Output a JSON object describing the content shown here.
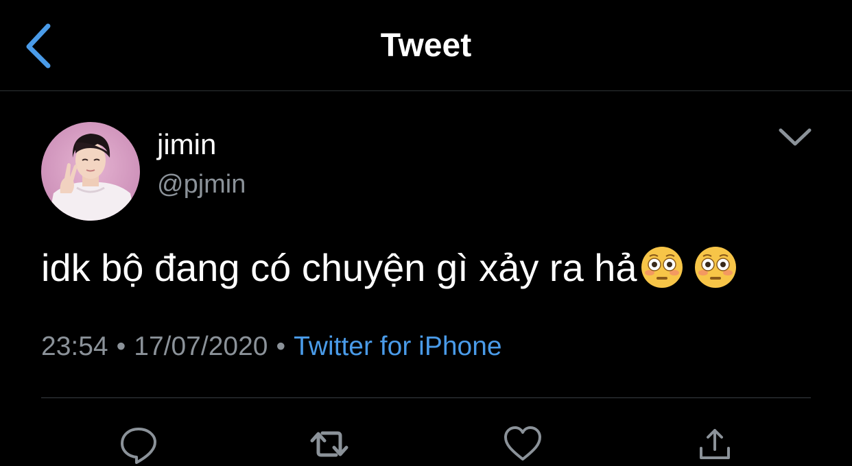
{
  "header": {
    "title": "Tweet",
    "back_icon": "chevron-left-icon",
    "accent_color": "#4a9be8"
  },
  "tweet": {
    "author": {
      "display_name": "jimin",
      "handle": "@pjmin"
    },
    "text": "idk bộ đang có chuyện gì xảy ra hả",
    "emojis": [
      "flushed-face-emoji",
      "flushed-face-emoji"
    ],
    "time": "23:54",
    "date": "17/07/2020",
    "separator": "•",
    "source": "Twitter for iPhone"
  },
  "actions": {
    "reply": "reply-icon",
    "retweet": "retweet-icon",
    "like": "heart-icon",
    "share": "share-icon"
  },
  "colors": {
    "background": "#000000",
    "text": "#ffffff",
    "secondary_text": "#8b9299",
    "link": "#4a9be8",
    "divider": "#2f3336"
  }
}
